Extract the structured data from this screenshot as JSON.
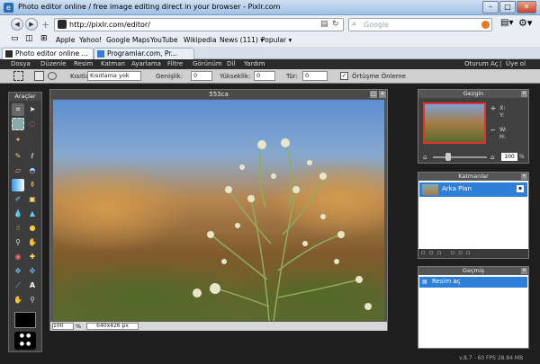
{
  "window": {
    "title": "Photo editor online / free image editing direct in your browser - Pixlr.com",
    "min": "–",
    "max": "□",
    "close": "✕"
  },
  "nav": {
    "url": "http://pixlr.com/editor/",
    "search_placeholder": "Google",
    "back": "◀",
    "forward": "▶"
  },
  "bookmarks": [
    "Apple",
    "Yahoo!",
    "Google Maps",
    "YouTube",
    "Wikipedia",
    "News (111) ▾",
    "Popular ▾"
  ],
  "tabs": [
    {
      "label": "Photo editor online ..."
    },
    {
      "label": "Programlar.com, Pr..."
    }
  ],
  "app_menu": {
    "items": [
      "Dosya",
      "Düzenle",
      "Resim",
      "Katman",
      "Ayarlama",
      "Filtre",
      "Görünüm",
      "Dil",
      "Yardım"
    ],
    "right": [
      "Oturum Aç",
      "|",
      "Üye ol"
    ]
  },
  "tool_options": {
    "kisitla_label": "Kısıtla:",
    "kisitla_value": "Kısıtlama yok",
    "genislik_label": "Genişlik:",
    "genislik_value": "0",
    "yukseklik_label": "Yükseklik:",
    "yukseklik_value": "0",
    "tur_label": "Tür:",
    "tur_value": "0",
    "ortusme_label": "Örtüşme Önleme"
  },
  "tools_panel": {
    "title": "Araçlar"
  },
  "canvas": {
    "title": "553ca",
    "zoom": "100",
    "zoom_unit": "%",
    "size": "640x426 px"
  },
  "navigator": {
    "title": "Gezgin",
    "x_label": "X:",
    "y_label": "Y:",
    "w_label": "W:",
    "h_label": "H:",
    "zoom": "100",
    "zoom_unit": "%"
  },
  "layers": {
    "title": "Katmanlar",
    "layer_name": "Arka Plan"
  },
  "history": {
    "title": "Geçmiş",
    "item": "Resim aç"
  },
  "status": {
    "text": "v.8.7 - 60 FPS 28.84 MB"
  },
  "colors": {
    "accent": "#2e7fd7",
    "app_bg": "#1e1e1e",
    "menu_bg": "#2b2b2b"
  }
}
